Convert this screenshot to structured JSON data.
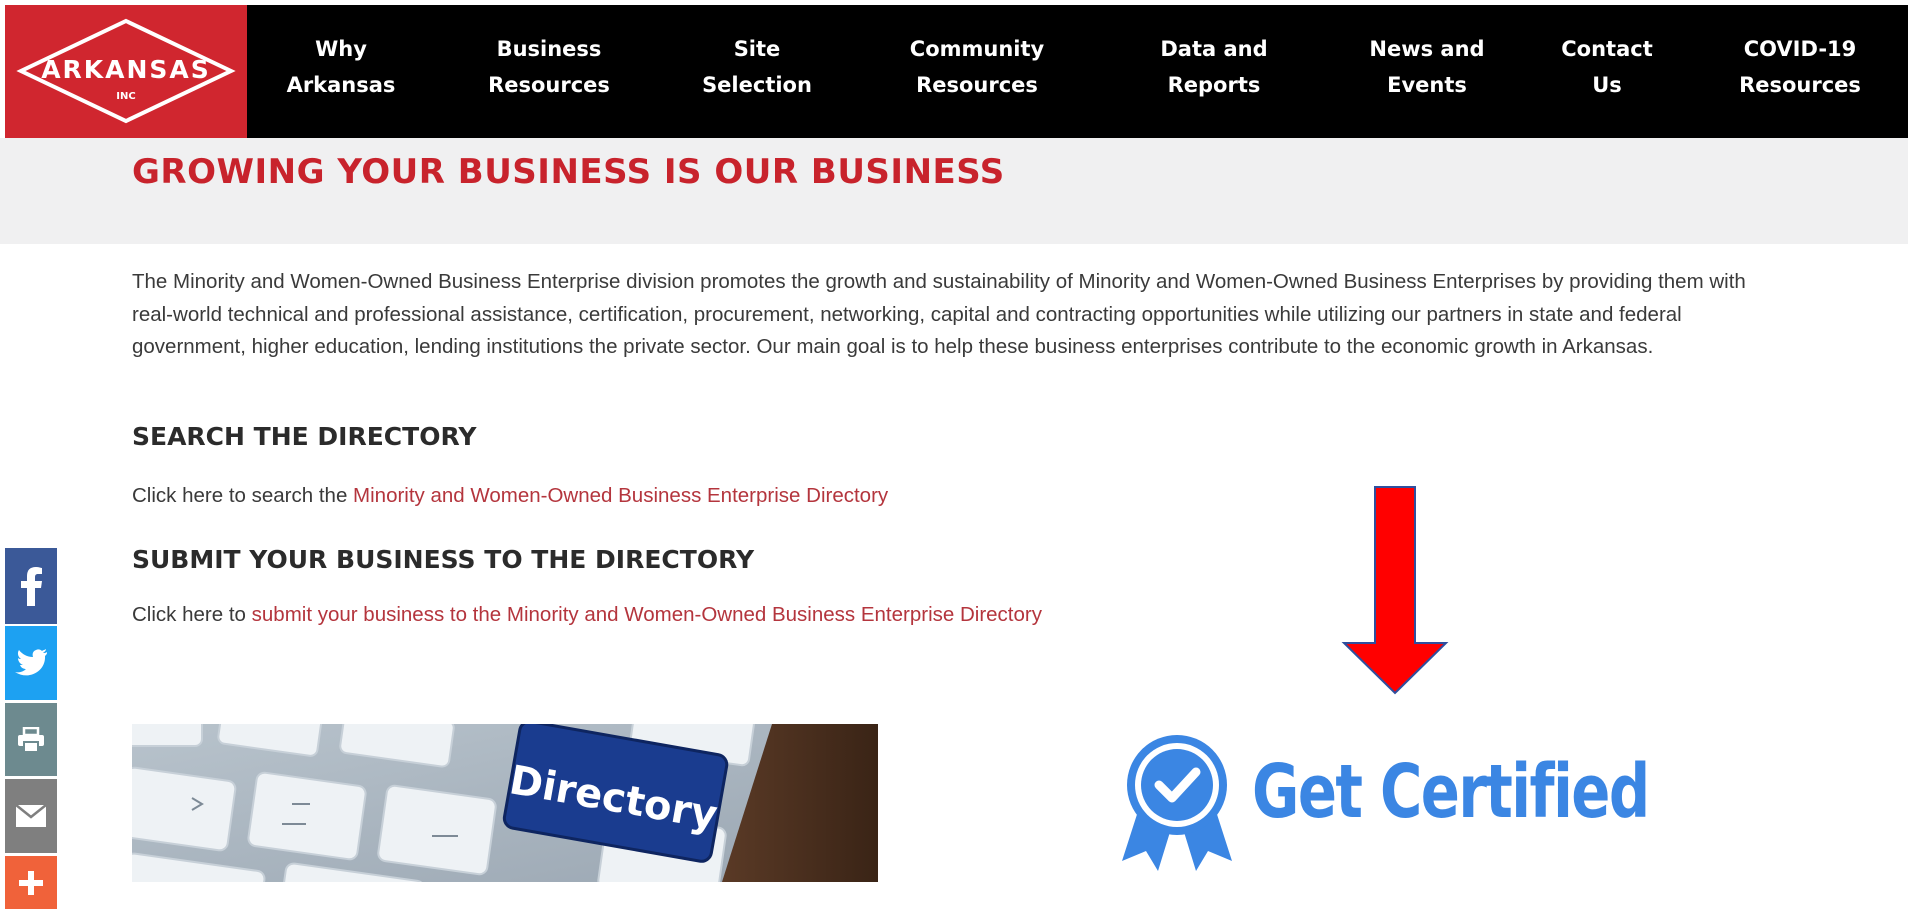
{
  "header": {
    "logo": {
      "name": "ARKANSAS",
      "sub": "INC"
    },
    "nav": [
      {
        "line1": "Why",
        "line2": "Arkansas"
      },
      {
        "line1": "Business",
        "line2": "Resources"
      },
      {
        "line1": "Site",
        "line2": "Selection"
      },
      {
        "line1": "Community",
        "line2": "Resources"
      },
      {
        "line1": "Data and",
        "line2": "Reports"
      },
      {
        "line1": "News and",
        "line2": "Events"
      },
      {
        "line1": "Contact",
        "line2": "Us"
      },
      {
        "line1": "COVID-19",
        "line2": "Resources"
      }
    ]
  },
  "hero": {
    "title": "GROWING YOUR BUSINESS IS OUR BUSINESS"
  },
  "intro": "The Minority and Women-Owned Business Enterprise division promotes the growth and sustainability of Minority and Women-Owned Business Enterprises by providing them with real-world technical and professional assistance, certification, procurement, networking, capital and contracting opportunities while utilizing our partners in state and federal government, higher education, lending institutions the private sector. Our main goal is to help these business enterprises contribute to the economic growth in Arkansas.",
  "search": {
    "heading": "SEARCH THE DIRECTORY",
    "prefix": "Click here to search the ",
    "link": "Minority and Women-Owned Business Enterprise Directory"
  },
  "submit": {
    "heading": "SUBMIT YOUR BUSINESS TO THE DIRECTORY",
    "prefix": "Click here to ",
    "link": "submit your business to the Minority and Women-Owned Business Enterprise Directory"
  },
  "directory_image": {
    "key_text": "Directory"
  },
  "certified": {
    "label": "Get Certified"
  },
  "social": [
    {
      "name": "facebook",
      "color": "#3b5998"
    },
    {
      "name": "twitter",
      "color": "#1da1f2"
    },
    {
      "name": "print",
      "color": "#6d8a8f"
    },
    {
      "name": "email",
      "color": "#7f7f7f"
    },
    {
      "name": "more",
      "color": "#f0623a"
    }
  ],
  "colors": {
    "brand_red": "#d0262f",
    "link": "#b4353d",
    "certified_blue": "#3b86e3",
    "arrow_red": "#ff0000"
  }
}
